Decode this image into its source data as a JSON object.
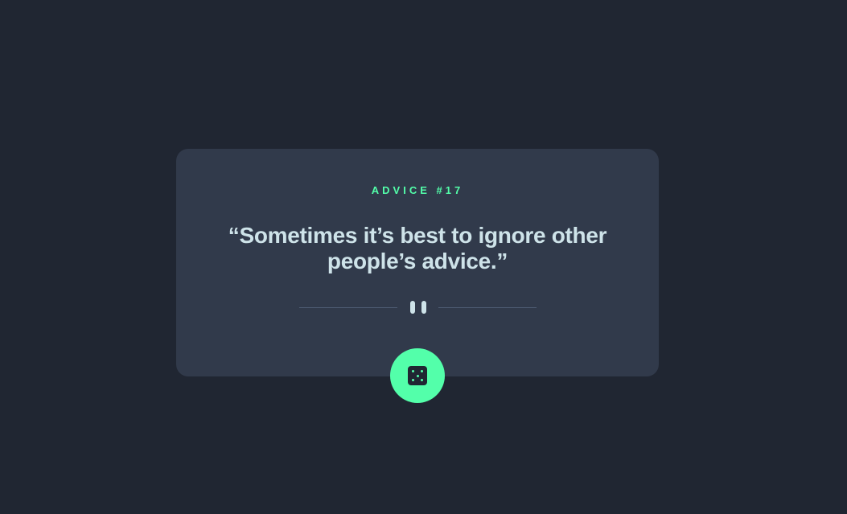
{
  "advice": {
    "label": "ADVICE #17",
    "quote": "“Sometimes it’s best to ignore other people’s advice.”"
  },
  "colors": {
    "background": "#202632",
    "card": "#313a4b",
    "accent": "#53ffaa",
    "text": "#cee3e9",
    "divider": "#4f5d74"
  },
  "icons": {
    "divider": "pause-icon",
    "button": "dice-icon"
  }
}
